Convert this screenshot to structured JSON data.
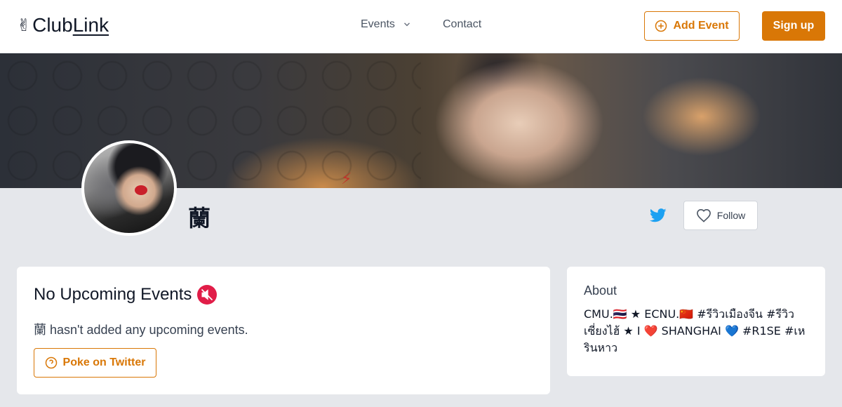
{
  "header": {
    "logo_hand": "✌",
    "logo_club": "Club",
    "logo_link": "Link",
    "nav_events": "Events",
    "nav_contact": "Contact",
    "add_event_label": "Add Event",
    "signup_label": "Sign up"
  },
  "colors": {
    "accent": "#d97706",
    "twitter": "#1da1f2",
    "page_bg": "#e5e7eb"
  },
  "profile": {
    "name": "蘭",
    "follow_label": "Follow"
  },
  "events_card": {
    "title": "No Upcoming Events",
    "title_icon": "muted-speaker-icon",
    "description": "蘭 hasn't added any upcoming events.",
    "poke_label": "Poke on Twitter"
  },
  "about_card": {
    "title": "About",
    "bio": "CMU.🇹🇭 ★ ECNU.🇨🇳 #รีวิวเมืองจีน #รีวิวเซี่ยงไฮ้ ★ I ❤️ SHANGHAI 💙 #R1SE #เหรินหาว"
  }
}
